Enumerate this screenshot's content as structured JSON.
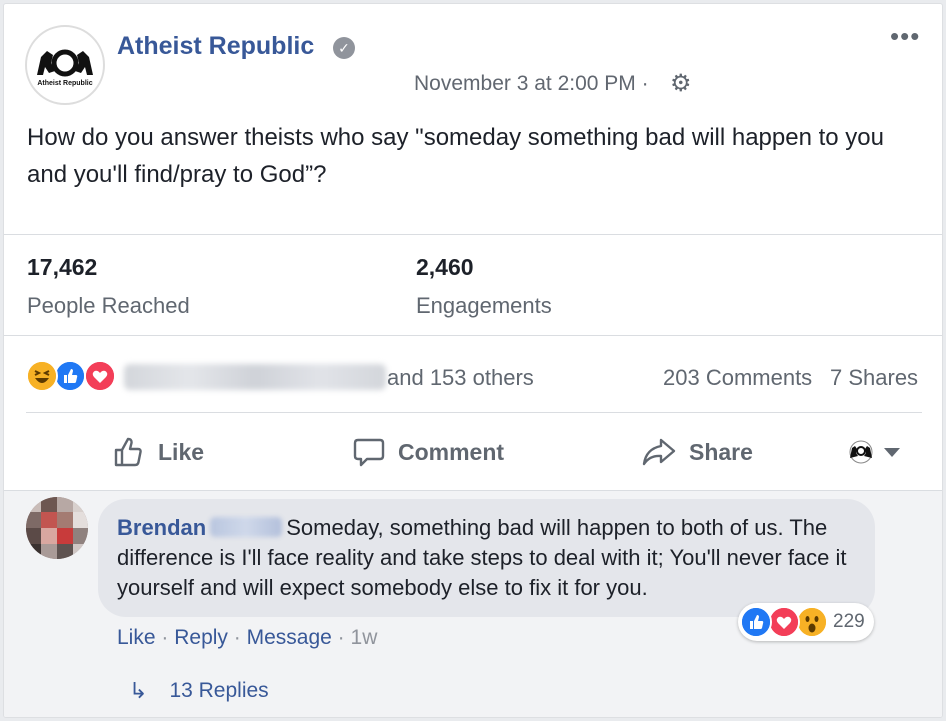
{
  "post": {
    "page_name": "Atheist Republic",
    "logo_text": "Atheist Republic",
    "timestamp": "November 3 at 2:00 PM ·",
    "more_icon": "more-horizontal-icon",
    "text": "How do you answer theists who say \"someday something bad will happen to you and you'll find/pray to God”?"
  },
  "insights": {
    "reached_value": "17,462",
    "reached_label": "People Reached",
    "engagements_value": "2,460",
    "engagements_label": "Engagements"
  },
  "reactions": {
    "icons": [
      "haha-icon",
      "like-icon",
      "love-icon"
    ],
    "others_text": "and 153 others",
    "comments": "203 Comments",
    "shares": "7 Shares"
  },
  "actions": {
    "like": "Like",
    "comment": "Comment",
    "share": "Share"
  },
  "comment": {
    "author": "Brendan",
    "text": "Someday, something bad will happen to both of us. The difference is I'll face reality and take steps to deal with it; You'll never face it yourself and will expect somebody else to fix it for you.",
    "reaction_count": "229",
    "like": "Like",
    "reply": "Reply",
    "message": "Message",
    "time": "1w",
    "sep": "·"
  },
  "replies": {
    "label": "13 Replies"
  },
  "colors": {
    "link_blue": "#385898",
    "text_dark": "#1d2129",
    "text_gray": "#606770",
    "like_blue": "#2078f4",
    "love_red": "#f33e58",
    "haha_yellow": "#f7b125"
  }
}
